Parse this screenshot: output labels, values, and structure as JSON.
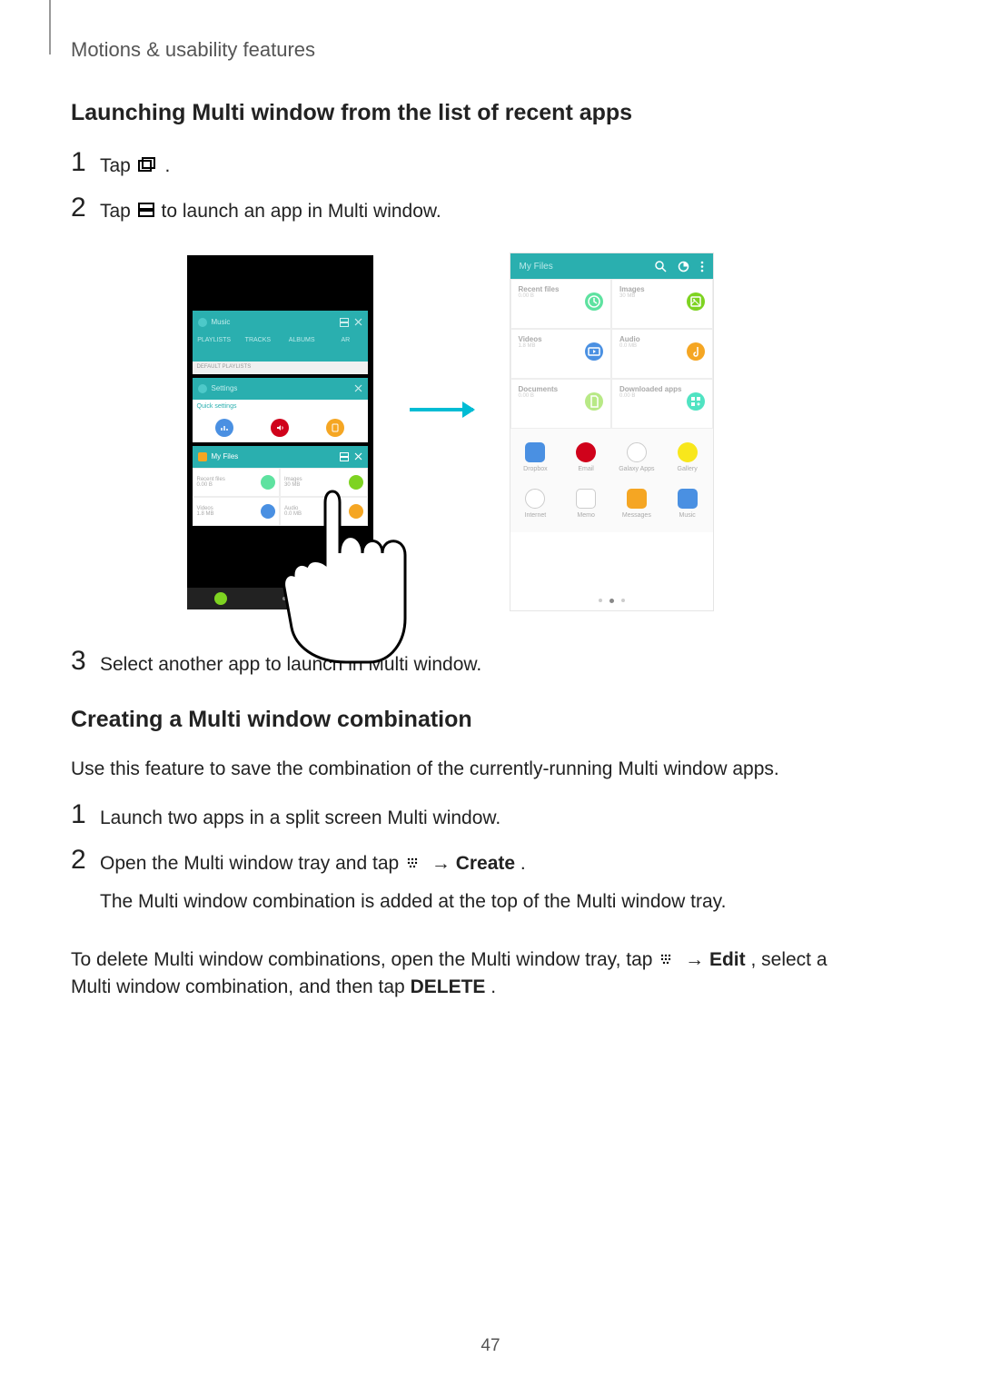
{
  "header": {
    "chapter": "Motions & usability features"
  },
  "sectionA": {
    "heading": "Launching Multi window from the list of recent apps",
    "steps": {
      "s1": {
        "num": "1",
        "t1": "Tap ",
        "t2": "."
      },
      "s2": {
        "num": "2",
        "t1": "Tap ",
        "t2": " to launch an app in Multi window."
      },
      "s3": {
        "num": "3",
        "t1": "Select another app to launch in Multi window."
      }
    }
  },
  "figure": {
    "phone1": {
      "music_title": "Music",
      "music_tabs": [
        "PLAYLISTS",
        "TRACKS",
        "ALBUMS",
        "AR"
      ],
      "grey_label": "DEFAULT PLAYLISTS",
      "settings_title": "Settings",
      "quick_label": "Quick settings",
      "files_title": "My Files",
      "cells": {
        "recent": {
          "t": "Recent files",
          "s": "0.00 B"
        },
        "images": {
          "t": "Images",
          "s": "30 MB"
        },
        "videos": {
          "t": "Videos",
          "s": "1.8 MB"
        },
        "audio": {
          "t": "Audio",
          "s": "0.0 MB"
        }
      }
    },
    "phone2": {
      "title": "My Files",
      "cells": {
        "recent": {
          "t": "Recent files",
          "s": "0.00 B"
        },
        "images": {
          "t": "Images",
          "s": "30 MB"
        },
        "videos": {
          "t": "Videos",
          "s": "1.8 MB"
        },
        "audio": {
          "t": "Audio",
          "s": "0.0 MB"
        },
        "docs": {
          "t": "Documents",
          "s": "0.00 B"
        },
        "dl": {
          "t": "Downloaded apps",
          "s": "0.00 B"
        }
      },
      "apps": {
        "dropbox": "Dropbox",
        "email": "Email",
        "galaxy": "Galaxy Apps",
        "gallery": "Gallery",
        "internet": "Internet",
        "memo": "Memo",
        "messages": "Messages",
        "music": "Music"
      }
    }
  },
  "sectionB": {
    "heading": "Creating a Multi window combination",
    "intro": "Use this feature to save the combination of the currently-running Multi window apps.",
    "steps": {
      "s1": {
        "num": "1",
        "t": "Launch two apps in a split screen Multi window."
      },
      "s2": {
        "num": "2",
        "t1": "Open the Multi window tray and tap ",
        "arrow": " → ",
        "create": "Create",
        "t2": ".",
        "note": "The Multi window combination is added at the top of the Multi window tray."
      }
    },
    "outro": {
      "t1": "To delete Multi window combinations, open the Multi window tray, tap ",
      "arrow": " → ",
      "edit": "Edit",
      "t2": ", select a Multi window combination, and then tap ",
      "del": "DELETE",
      "t3": "."
    }
  },
  "pageNumber": "47"
}
